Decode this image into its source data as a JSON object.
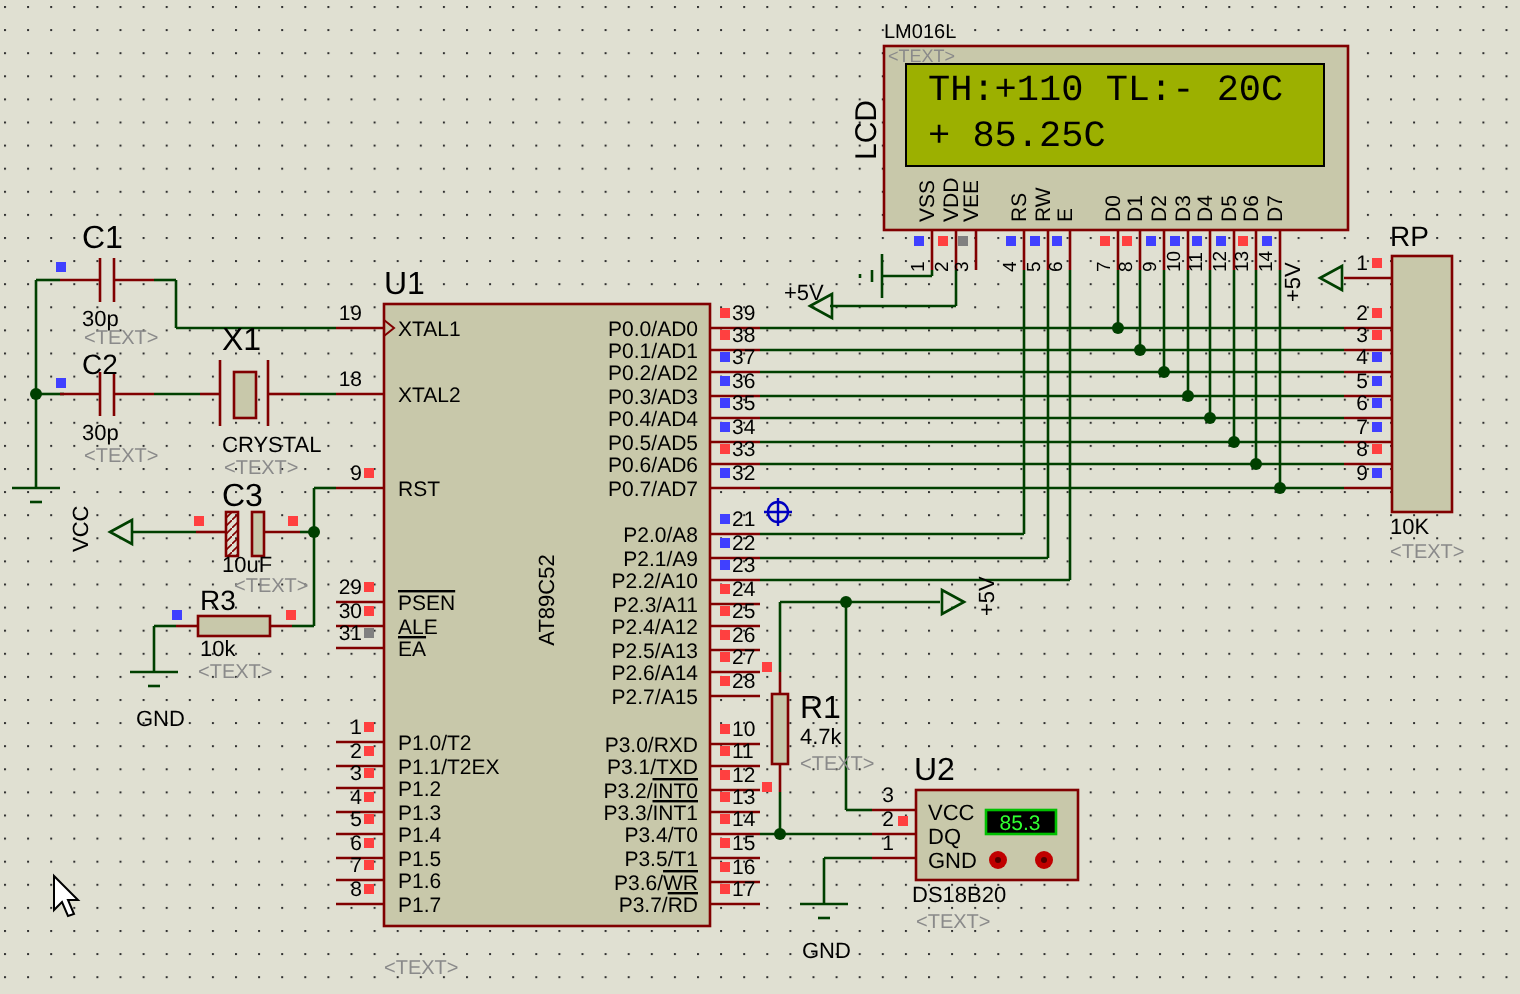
{
  "u1": {
    "ref": "U1",
    "part": "AT89C52",
    "text": "<TEXT>",
    "left_pins": [
      {
        "number": "19",
        "label": "XTAL1",
        "inverted": false,
        "clock": true
      },
      {
        "number": "18",
        "label": "XTAL2",
        "inverted": false,
        "clock": false
      },
      {
        "number": "9",
        "label": "RST",
        "color": "#ff4040",
        "inverted": false,
        "clock": false
      },
      {
        "number": "29",
        "label": "PSEN",
        "color": "#ff4040",
        "inverted": true,
        "clock": false
      },
      {
        "number": "30",
        "label": "ALE",
        "color": "#ff4040",
        "inverted": false,
        "clock": false
      },
      {
        "number": "31",
        "label": "EA",
        "color": "#808080",
        "inverted": true,
        "clock": false
      },
      {
        "number": "1",
        "label": "P1.0/T2",
        "color": "#ff4040",
        "inverted": false,
        "clock": false
      },
      {
        "number": "2",
        "label": "P1.1/T2EX",
        "color": "#ff4040",
        "inverted": false,
        "clock": false
      },
      {
        "number": "3",
        "label": "P1.2",
        "color": "#ff4040",
        "inverted": false,
        "clock": false
      },
      {
        "number": "4",
        "label": "P1.3",
        "color": "#ff4040",
        "inverted": false,
        "clock": false
      },
      {
        "number": "5",
        "label": "P1.4",
        "color": "#ff4040",
        "inverted": false,
        "clock": false
      },
      {
        "number": "6",
        "label": "P1.5",
        "color": "#ff4040",
        "inverted": false,
        "clock": false
      },
      {
        "number": "7",
        "label": "P1.6",
        "color": "#ff4040",
        "inverted": false,
        "clock": false
      },
      {
        "number": "8",
        "label": "P1.7",
        "color": "#ff4040",
        "inverted": false,
        "clock": false
      }
    ],
    "right_pins": [
      {
        "number": "39",
        "label": "P0.0/AD0",
        "color": "#ff4040",
        "inverted": false
      },
      {
        "number": "38",
        "label": "P0.1/AD1",
        "color": "#ff4040",
        "inverted": false
      },
      {
        "number": "37",
        "label": "P0.2/AD2",
        "color": "#4040ff",
        "inverted": false
      },
      {
        "number": "36",
        "label": "P0.3/AD3",
        "color": "#4040ff",
        "inverted": false
      },
      {
        "number": "35",
        "label": "P0.4/AD4",
        "color": "#4040ff",
        "inverted": false
      },
      {
        "number": "34",
        "label": "P0.5/AD5",
        "color": "#4040ff",
        "inverted": false
      },
      {
        "number": "33",
        "label": "P0.6/AD6",
        "color": "#ff4040",
        "inverted": false
      },
      {
        "number": "32",
        "label": "P0.7/AD7",
        "color": "#4040ff",
        "inverted": false
      },
      {
        "number": "21",
        "label": "P2.0/A8",
        "color": "#4040ff",
        "inverted": false
      },
      {
        "number": "22",
        "label": "P2.1/A9",
        "color": "#4040ff",
        "inverted": false
      },
      {
        "number": "23",
        "label": "P2.2/A10",
        "color": "#4040ff",
        "inverted": false
      },
      {
        "number": "24",
        "label": "P2.3/A11",
        "color": "#ff4040",
        "inverted": false
      },
      {
        "number": "25",
        "label": "P2.4/A12",
        "color": "#ff4040",
        "inverted": false
      },
      {
        "number": "26",
        "label": "P2.5/A13",
        "color": "#ff4040",
        "inverted": false
      },
      {
        "number": "27",
        "label": "P2.6/A14",
        "color": "#ff4040",
        "inverted": false
      },
      {
        "number": "28",
        "label": "P2.7/A15",
        "color": "#ff4040",
        "inverted": false
      },
      {
        "number": "10",
        "label": "P3.0/RXD",
        "color": "#ff4040",
        "inverted": false
      },
      {
        "number": "11",
        "label": "P3.1/TXD",
        "color": "#ff4040",
        "inverted": false
      },
      {
        "number": "12",
        "label": "P3.2/INT0",
        "color": "#ff4040",
        "inverted": true
      },
      {
        "number": "13",
        "label": "P3.3/INT1",
        "color": "#ff4040",
        "inverted": true
      },
      {
        "number": "14",
        "label": "P3.4/T0",
        "color": "#ff4040",
        "inverted": false
      },
      {
        "number": "15",
        "label": "P3.5/T1",
        "color": "#ff4040",
        "inverted": false
      },
      {
        "number": "16",
        "label": "P3.6/WR",
        "color": "#ff4040",
        "inverted": true
      },
      {
        "number": "17",
        "label": "P3.7/RD",
        "color": "#ff4040",
        "inverted": true
      }
    ]
  },
  "lcd": {
    "ref": "LCD",
    "part": "LM016L",
    "text": "<TEXT>",
    "lines": [
      "TH:+110 TL:- 20C",
      "+ 85.25C"
    ],
    "pins": [
      {
        "number": "1",
        "label": "VSS",
        "color": "#4040ff"
      },
      {
        "number": "2",
        "label": "VDD",
        "color": "#ff4040"
      },
      {
        "number": "3",
        "label": "VEE",
        "color": "#808080"
      },
      {
        "number": "4",
        "label": "RS",
        "color": "#4040ff"
      },
      {
        "number": "5",
        "label": "RW",
        "color": "#4040ff"
      },
      {
        "number": "6",
        "label": "E",
        "color": "#4040ff"
      },
      {
        "number": "7",
        "label": "D0",
        "color": "#ff4040"
      },
      {
        "number": "8",
        "label": "D1",
        "color": "#ff4040"
      },
      {
        "number": "9",
        "label": "D2",
        "color": "#4040ff"
      },
      {
        "number": "10",
        "label": "D3",
        "color": "#4040ff"
      },
      {
        "number": "11",
        "label": "D4",
        "color": "#4040ff"
      },
      {
        "number": "12",
        "label": "D5",
        "color": "#4040ff"
      },
      {
        "number": "13",
        "label": "D6",
        "color": "#ff4040"
      },
      {
        "number": "14",
        "label": "D7",
        "color": "#4040ff"
      }
    ]
  },
  "resistor_pack": {
    "ref": "RP",
    "value": "10K",
    "text": "<TEXT>",
    "pins": [
      {
        "number": "1",
        "color": "#ff4040"
      },
      {
        "number": "2",
        "color": "#ff4040"
      },
      {
        "number": "3",
        "color": "#ff4040"
      },
      {
        "number": "4",
        "color": "#4040ff"
      },
      {
        "number": "5",
        "color": "#4040ff"
      },
      {
        "number": "6",
        "color": "#4040ff"
      },
      {
        "number": "7",
        "color": "#4040ff"
      },
      {
        "number": "8",
        "color": "#ff4040"
      },
      {
        "number": "9",
        "color": "#4040ff"
      }
    ]
  },
  "sensor": {
    "ref": "U2",
    "part": "DS18B20",
    "text": "<TEXT>",
    "reading": "85.3",
    "pins": [
      {
        "number": "3",
        "label": "VCC"
      },
      {
        "number": "2",
        "label": "DQ",
        "color": "#ff4040"
      },
      {
        "number": "1",
        "label": "GND"
      }
    ]
  },
  "passives": [
    {
      "kind": "capacitor",
      "ref": "C1",
      "value": "30p",
      "text": "<TEXT>",
      "pins": [
        {
          "color": "#4040ff"
        }
      ]
    },
    {
      "kind": "capacitor",
      "ref": "C2",
      "value": "30p",
      "text": "<TEXT>",
      "pins": [
        {
          "color": "#4040ff"
        }
      ]
    },
    {
      "kind": "crystal",
      "ref": "X1",
      "value": "CRYSTAL",
      "text": "<TEXT>"
    },
    {
      "kind": "electrolytic",
      "ref": "C3",
      "value": "10uF",
      "text": "<TEXT>",
      "pins": [
        {
          "color": "#ff4040"
        },
        {
          "color": "#ff4040"
        }
      ]
    },
    {
      "kind": "resistor",
      "ref": "R3",
      "value": "10k",
      "text": "<TEXT>",
      "pins": [
        {
          "color": "#4040ff"
        },
        {
          "color": "#ff4040"
        }
      ]
    },
    {
      "kind": "resistor",
      "ref": "R1",
      "value": "4.7k",
      "text": "<TEXT>",
      "pins": [
        {
          "color": "#ff4040"
        },
        {
          "color": "#ff4040"
        }
      ]
    }
  ],
  "terminals": [
    {
      "kind": "power",
      "label": "+5V"
    },
    {
      "kind": "power",
      "label": "+5V"
    },
    {
      "kind": "ground"
    },
    {
      "kind": "ground"
    },
    {
      "kind": "power",
      "label": "VCC"
    },
    {
      "kind": "ground",
      "label": "GND"
    },
    {
      "kind": "power",
      "label": "+5V"
    },
    {
      "kind": "ground",
      "label": "GND"
    }
  ]
}
